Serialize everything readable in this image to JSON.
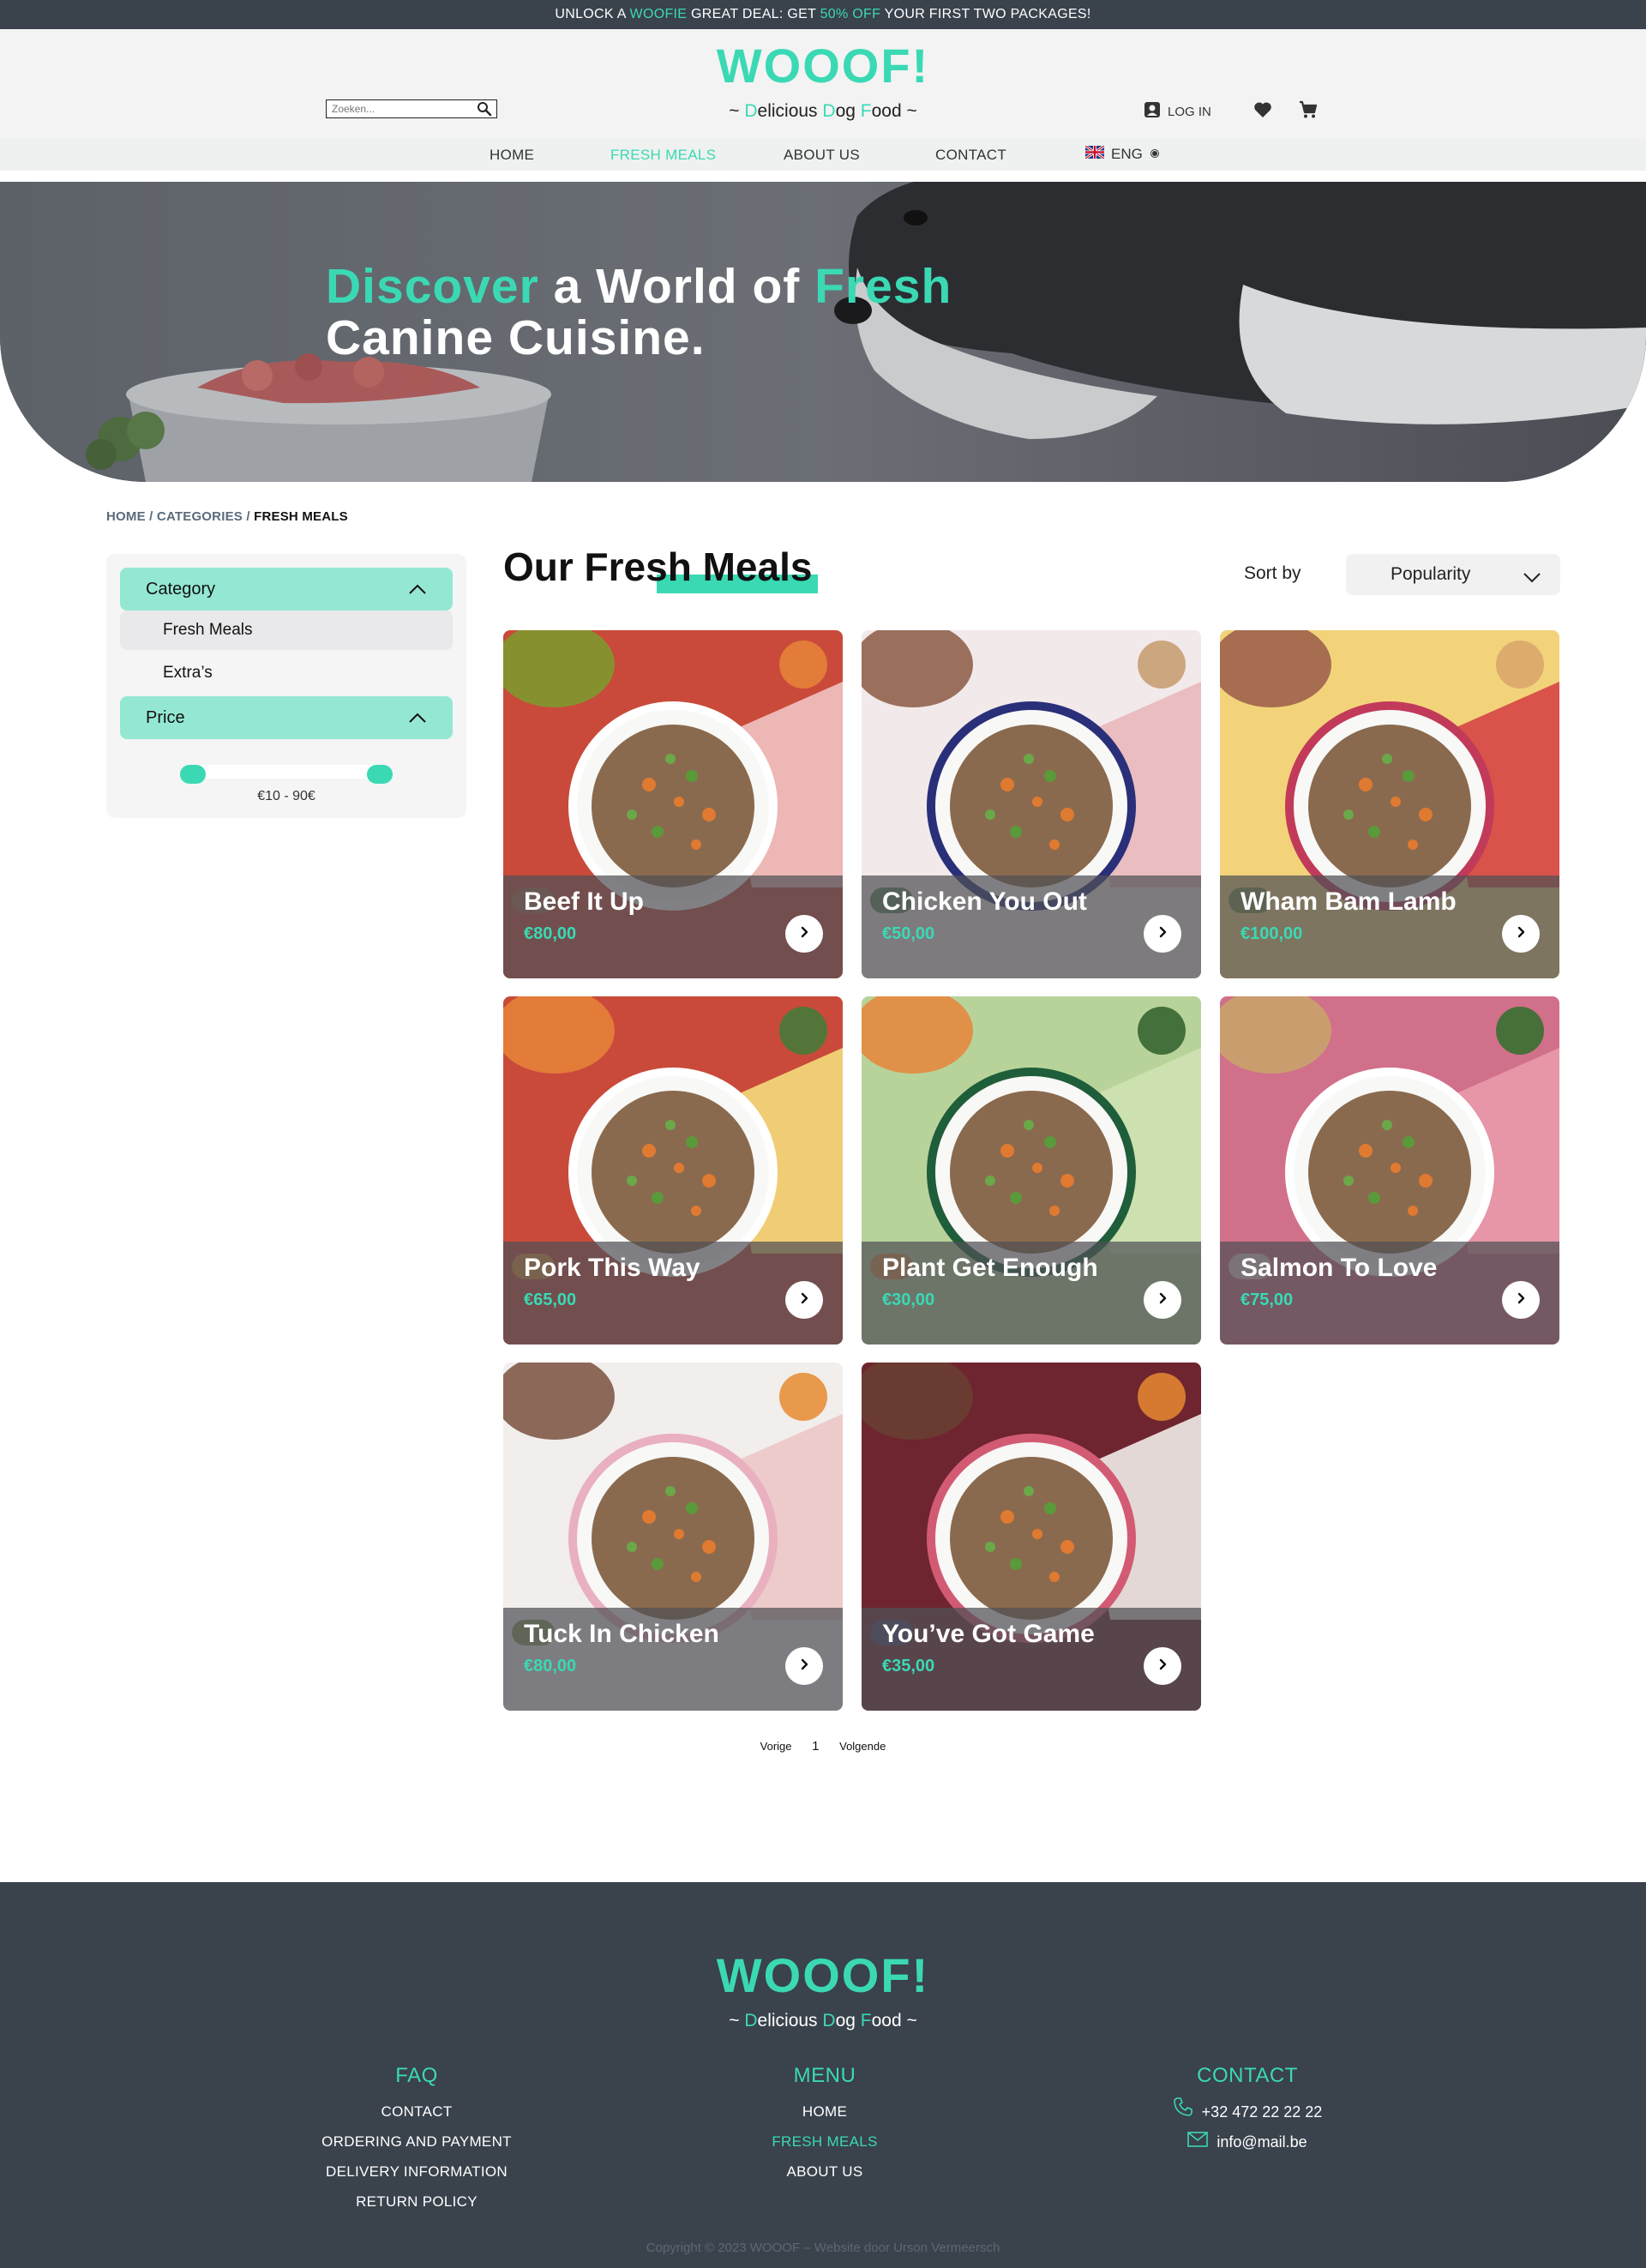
{
  "announcement": {
    "part1": "UNLOCK A ",
    "highlight1": "WOOFIE",
    "part2": " GREAT DEAL: GET ",
    "highlight2": "50% OFF",
    "part3": " YOUR FIRST TWO PACKAGES!"
  },
  "brand": {
    "logo": "WOOOF!",
    "tagline": {
      "prefix": "~ ",
      "d1": "D",
      "w1": "elicious ",
      "d2": "D",
      "w2": "og ",
      "d3": "F",
      "w3": "ood",
      "suffix": " ~"
    }
  },
  "header": {
    "search_placeholder": "Zoeken...",
    "login_label": "LOG IN"
  },
  "nav": {
    "items": [
      "HOME",
      "FRESH MEALS",
      "ABOUT US",
      "CONTACT"
    ],
    "active": "FRESH MEALS",
    "language": "ENG"
  },
  "hero": {
    "w1": "Discover",
    "w2": " a World of ",
    "w3": "Fresh",
    "line2": "Canine Cuisine."
  },
  "breadcrumb": {
    "home": "HOME",
    "categories": "CATEGORIES",
    "sep": " / ",
    "current": "FRESH MEALS"
  },
  "filters": {
    "category_label": "Category",
    "category_items": [
      "Fresh Meals",
      "Extra’s"
    ],
    "price_label": "Price",
    "price_range_text": "€10 - 90€"
  },
  "content": {
    "title": "Our Fresh Meals",
    "sort_label": "Sort by",
    "sort_value": "Popularity"
  },
  "products": [
    {
      "name": "Beef It Up",
      "price": "€80,00"
    },
    {
      "name": "Chicken You Out",
      "price": "€50,00"
    },
    {
      "name": "Wham Bam Lamb",
      "price": "€100,00"
    },
    {
      "name": "Pork This Way",
      "price": "€65,00"
    },
    {
      "name": "Plant Get Enough",
      "price": "€30,00"
    },
    {
      "name": "Salmon To Love",
      "price": "€75,00"
    },
    {
      "name": "Tuck In Chicken",
      "price": "€80,00"
    },
    {
      "name": "You’ve Got Game",
      "price": "€35,00"
    }
  ],
  "pagination": {
    "prev": "Vorige",
    "page": "1",
    "next": "Volgende"
  },
  "footer": {
    "faq": {
      "heading": "FAQ",
      "links": [
        "CONTACT",
        "ORDERING AND PAYMENT",
        "DELIVERY INFORMATION",
        "RETURN POLICY"
      ]
    },
    "menu": {
      "heading": "MENU",
      "links": [
        "HOME",
        "FRESH MEALS",
        "ABOUT US"
      ]
    },
    "contact": {
      "heading": "CONTACT",
      "phone": "+32 472 22 22 22",
      "email": "info@mail.be"
    },
    "copyright": "Copyright © 2023 WOOOF –  Website door Urson Vermeersch"
  },
  "colors": {
    "accent": "#3ad9b4",
    "dark": "#3a424c",
    "accent_light": "#94e8d3"
  },
  "icons": [
    "search-icon",
    "account-icon",
    "heart-icon",
    "cart-icon",
    "uk-flag-icon",
    "chevron-up-icon",
    "chevron-down-icon",
    "chevron-right-icon",
    "phone-icon",
    "mail-icon"
  ]
}
